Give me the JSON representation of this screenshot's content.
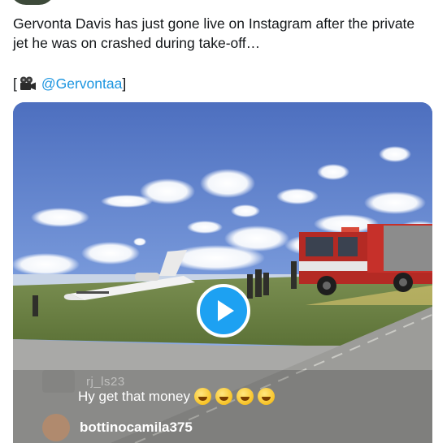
{
  "tweet": {
    "text": "Gervonta Davis has just gone live on Instagram after the private jet he was on crashed during take-off…",
    "credit_open": "[",
    "credit_icon": "movie-camera-icon",
    "credit_handle": "@Gervontaa",
    "credit_close": "]"
  },
  "video": {
    "play_icon": "play-icon",
    "comments": [
      {
        "user": "rj_ls23",
        "message": "Hy get that money",
        "emoji_count": 4
      },
      {
        "user": "bottinocamila375",
        "message": ""
      }
    ]
  },
  "colors": {
    "link": "#1b95e0",
    "play_button": "#1da1f2",
    "text": "#14171a"
  }
}
